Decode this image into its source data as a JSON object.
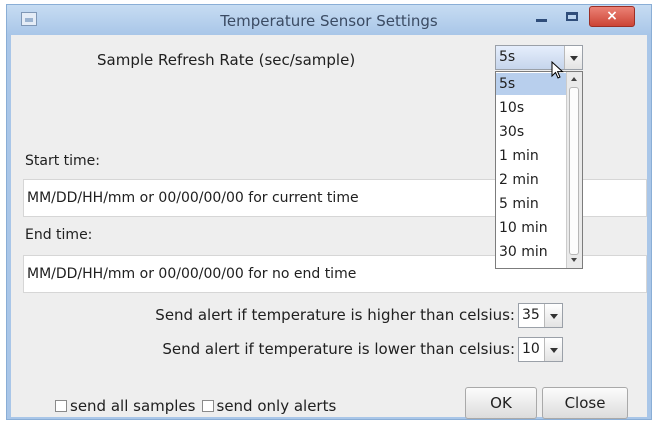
{
  "window": {
    "title": "Temperature Sensor Settings",
    "close_glyph": "×"
  },
  "refresh": {
    "label": "Sample Refresh Rate (sec/sample)",
    "selected": "5s",
    "options": [
      "5s",
      "10s",
      "30s",
      "1 min",
      "2 min",
      "5 min",
      "10 min",
      "30 min"
    ],
    "highlighted_index": 0
  },
  "start": {
    "label": "Start time:",
    "value": "MM/DD/HH/mm or 00/00/00/00 for current time"
  },
  "end": {
    "label": "End time:",
    "value": "MM/DD/HH/mm or 00/00/00/00 for no end time"
  },
  "alerts": {
    "high_label": "Send alert if temperature is higher than celsius:",
    "high_value": "35",
    "low_label": "Send alert if temperature is lower than celsius:",
    "low_value": "10"
  },
  "options": {
    "send_all_label": "send all samples",
    "send_alerts_label": "send only alerts"
  },
  "buttons": {
    "ok": "OK",
    "close": "Close"
  },
  "icons": {
    "app": "app-window-icon",
    "minimize": "minimize-icon",
    "maximize": "maximize-icon",
    "close": "close-icon",
    "dropdown": "chevron-down-icon",
    "cursor": "mouse-pointer-icon"
  },
  "colors": {
    "title_bar": "#a9c6e8",
    "close_button": "#d9564a",
    "selection": "#b8cfed",
    "panel": "#eeeeee"
  }
}
